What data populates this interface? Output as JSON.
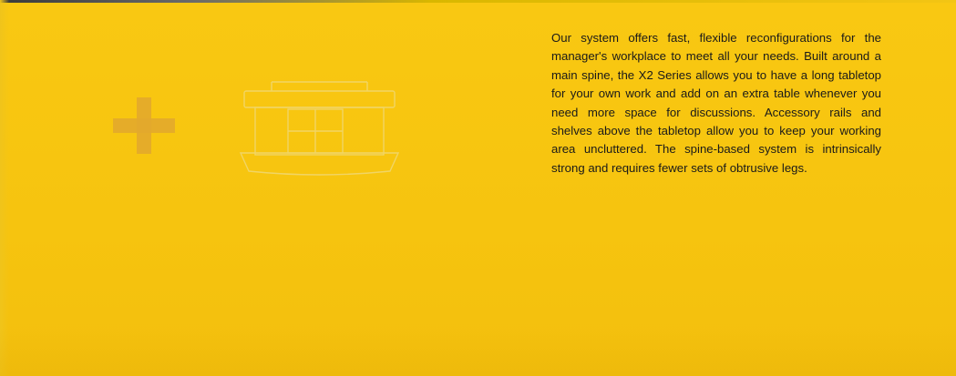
{
  "body_text": "Our system offers fast, flexible reconfigurations for the manager's workplace to meet all your needs. Built around a main spine, the X2 Series allows you to have a long tabletop for your own work and add on an extra table whenever you need more space for discussions. Accessory rails and shelves above the tabletop allow you to keep your working area uncluttered. The spine-based system is intrinsically strong and requires fewer sets of obtrusive legs.",
  "graphics": {
    "plus": "plus-icon",
    "plan": "desk-plan-diagram-icon"
  },
  "colors": {
    "background": "#f7c614",
    "plus": "#e2a92c",
    "diagram_lines": "#f1d66a",
    "text": "#1a1a1a"
  }
}
